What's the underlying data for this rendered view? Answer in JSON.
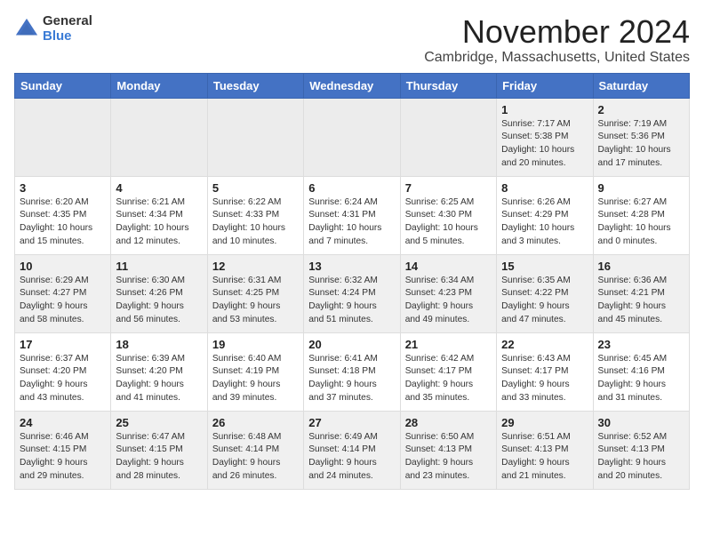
{
  "logo": {
    "general": "General",
    "blue": "Blue"
  },
  "title": "November 2024",
  "location": "Cambridge, Massachusetts, United States",
  "days_of_week": [
    "Sunday",
    "Monday",
    "Tuesday",
    "Wednesday",
    "Thursday",
    "Friday",
    "Saturday"
  ],
  "weeks": [
    [
      {
        "day": "",
        "info": ""
      },
      {
        "day": "",
        "info": ""
      },
      {
        "day": "",
        "info": ""
      },
      {
        "day": "",
        "info": ""
      },
      {
        "day": "",
        "info": ""
      },
      {
        "day": "1",
        "info": "Sunrise: 7:17 AM\nSunset: 5:38 PM\nDaylight: 10 hours\nand 20 minutes."
      },
      {
        "day": "2",
        "info": "Sunrise: 7:19 AM\nSunset: 5:36 PM\nDaylight: 10 hours\nand 17 minutes."
      }
    ],
    [
      {
        "day": "3",
        "info": "Sunrise: 6:20 AM\nSunset: 4:35 PM\nDaylight: 10 hours\nand 15 minutes."
      },
      {
        "day": "4",
        "info": "Sunrise: 6:21 AM\nSunset: 4:34 PM\nDaylight: 10 hours\nand 12 minutes."
      },
      {
        "day": "5",
        "info": "Sunrise: 6:22 AM\nSunset: 4:33 PM\nDaylight: 10 hours\nand 10 minutes."
      },
      {
        "day": "6",
        "info": "Sunrise: 6:24 AM\nSunset: 4:31 PM\nDaylight: 10 hours\nand 7 minutes."
      },
      {
        "day": "7",
        "info": "Sunrise: 6:25 AM\nSunset: 4:30 PM\nDaylight: 10 hours\nand 5 minutes."
      },
      {
        "day": "8",
        "info": "Sunrise: 6:26 AM\nSunset: 4:29 PM\nDaylight: 10 hours\nand 3 minutes."
      },
      {
        "day": "9",
        "info": "Sunrise: 6:27 AM\nSunset: 4:28 PM\nDaylight: 10 hours\nand 0 minutes."
      }
    ],
    [
      {
        "day": "10",
        "info": "Sunrise: 6:29 AM\nSunset: 4:27 PM\nDaylight: 9 hours\nand 58 minutes."
      },
      {
        "day": "11",
        "info": "Sunrise: 6:30 AM\nSunset: 4:26 PM\nDaylight: 9 hours\nand 56 minutes."
      },
      {
        "day": "12",
        "info": "Sunrise: 6:31 AM\nSunset: 4:25 PM\nDaylight: 9 hours\nand 53 minutes."
      },
      {
        "day": "13",
        "info": "Sunrise: 6:32 AM\nSunset: 4:24 PM\nDaylight: 9 hours\nand 51 minutes."
      },
      {
        "day": "14",
        "info": "Sunrise: 6:34 AM\nSunset: 4:23 PM\nDaylight: 9 hours\nand 49 minutes."
      },
      {
        "day": "15",
        "info": "Sunrise: 6:35 AM\nSunset: 4:22 PM\nDaylight: 9 hours\nand 47 minutes."
      },
      {
        "day": "16",
        "info": "Sunrise: 6:36 AM\nSunset: 4:21 PM\nDaylight: 9 hours\nand 45 minutes."
      }
    ],
    [
      {
        "day": "17",
        "info": "Sunrise: 6:37 AM\nSunset: 4:20 PM\nDaylight: 9 hours\nand 43 minutes."
      },
      {
        "day": "18",
        "info": "Sunrise: 6:39 AM\nSunset: 4:20 PM\nDaylight: 9 hours\nand 41 minutes."
      },
      {
        "day": "19",
        "info": "Sunrise: 6:40 AM\nSunset: 4:19 PM\nDaylight: 9 hours\nand 39 minutes."
      },
      {
        "day": "20",
        "info": "Sunrise: 6:41 AM\nSunset: 4:18 PM\nDaylight: 9 hours\nand 37 minutes."
      },
      {
        "day": "21",
        "info": "Sunrise: 6:42 AM\nSunset: 4:17 PM\nDaylight: 9 hours\nand 35 minutes."
      },
      {
        "day": "22",
        "info": "Sunrise: 6:43 AM\nSunset: 4:17 PM\nDaylight: 9 hours\nand 33 minutes."
      },
      {
        "day": "23",
        "info": "Sunrise: 6:45 AM\nSunset: 4:16 PM\nDaylight: 9 hours\nand 31 minutes."
      }
    ],
    [
      {
        "day": "24",
        "info": "Sunrise: 6:46 AM\nSunset: 4:15 PM\nDaylight: 9 hours\nand 29 minutes."
      },
      {
        "day": "25",
        "info": "Sunrise: 6:47 AM\nSunset: 4:15 PM\nDaylight: 9 hours\nand 28 minutes."
      },
      {
        "day": "26",
        "info": "Sunrise: 6:48 AM\nSunset: 4:14 PM\nDaylight: 9 hours\nand 26 minutes."
      },
      {
        "day": "27",
        "info": "Sunrise: 6:49 AM\nSunset: 4:14 PM\nDaylight: 9 hours\nand 24 minutes."
      },
      {
        "day": "28",
        "info": "Sunrise: 6:50 AM\nSunset: 4:13 PM\nDaylight: 9 hours\nand 23 minutes."
      },
      {
        "day": "29",
        "info": "Sunrise: 6:51 AM\nSunset: 4:13 PM\nDaylight: 9 hours\nand 21 minutes."
      },
      {
        "day": "30",
        "info": "Sunrise: 6:52 AM\nSunset: 4:13 PM\nDaylight: 9 hours\nand 20 minutes."
      }
    ]
  ]
}
